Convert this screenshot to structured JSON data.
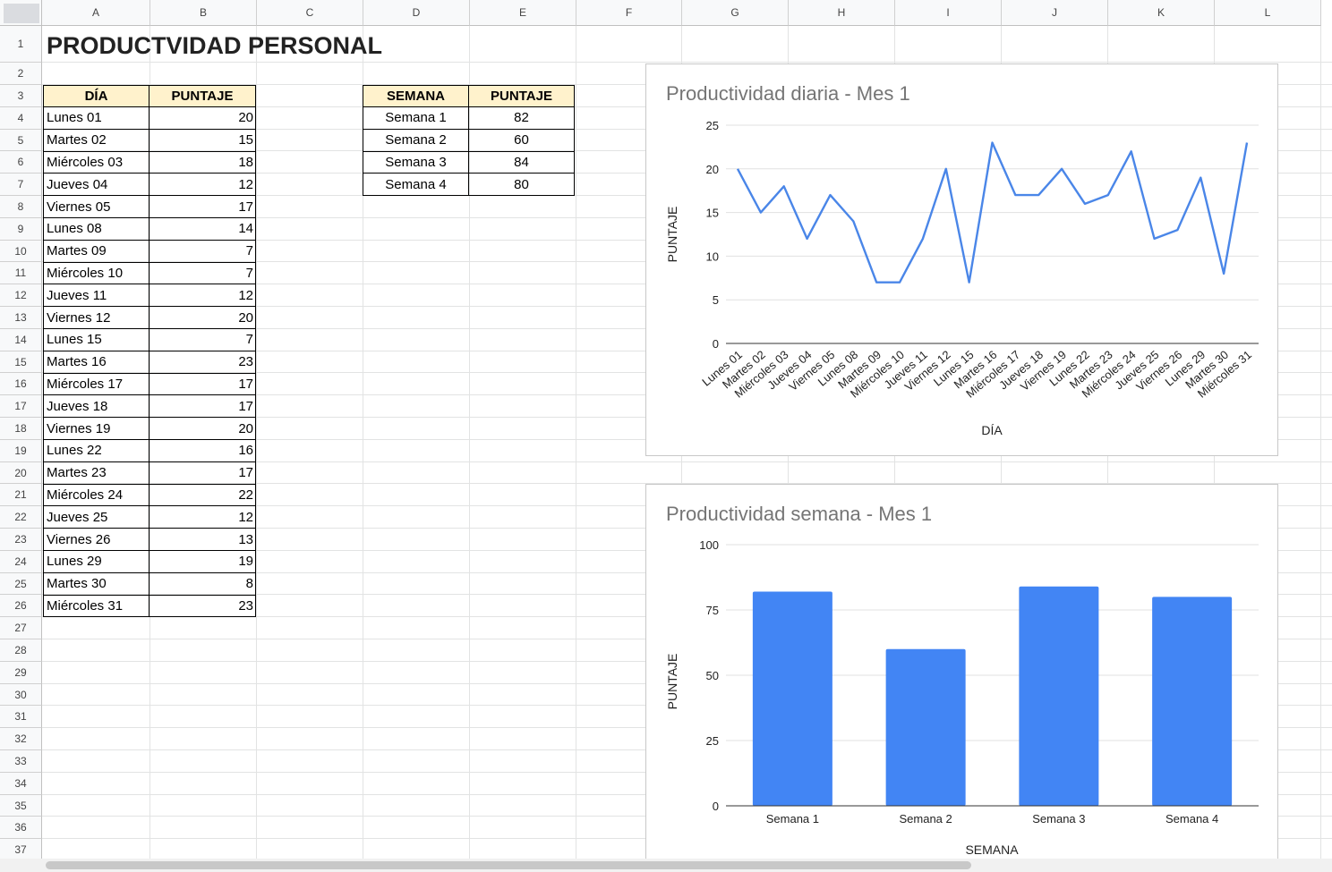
{
  "spreadsheet": {
    "columns": [
      "A",
      "B",
      "C",
      "D",
      "E",
      "F",
      "G",
      "H",
      "I",
      "J",
      "K",
      "L"
    ],
    "rows": [
      "1",
      "2",
      "3",
      "4",
      "5",
      "6",
      "7",
      "8",
      "9",
      "10",
      "11",
      "12",
      "13",
      "14",
      "15",
      "16",
      "17",
      "18",
      "19",
      "20",
      "21",
      "22",
      "23",
      "24",
      "25",
      "26",
      "27",
      "28",
      "29",
      "30",
      "31",
      "32",
      "33",
      "34",
      "35",
      "36",
      "37"
    ],
    "title": "PRODUCTVIDAD PERSONAL",
    "daily_table": {
      "headers": [
        "DÍA",
        "PUNTAJE"
      ],
      "rows": [
        [
          "Lunes 01",
          "20"
        ],
        [
          "Martes 02",
          "15"
        ],
        [
          "Miércoles 03",
          "18"
        ],
        [
          "Jueves 04",
          "12"
        ],
        [
          "Viernes 05",
          "17"
        ],
        [
          "Lunes 08",
          "14"
        ],
        [
          "Martes 09",
          "7"
        ],
        [
          "Miércoles 10",
          "7"
        ],
        [
          "Jueves 11",
          "12"
        ],
        [
          "Viernes 12",
          "20"
        ],
        [
          "Lunes 15",
          "7"
        ],
        [
          "Martes 16",
          "23"
        ],
        [
          "Miércoles 17",
          "17"
        ],
        [
          "Jueves 18",
          "17"
        ],
        [
          "Viernes 19",
          "20"
        ],
        [
          "Lunes 22",
          "16"
        ],
        [
          "Martes 23",
          "17"
        ],
        [
          "Miércoles 24",
          "22"
        ],
        [
          "Jueves 25",
          "12"
        ],
        [
          "Viernes 26",
          "13"
        ],
        [
          "Lunes 29",
          "19"
        ],
        [
          "Martes 30",
          "8"
        ],
        [
          "Miércoles 31",
          "23"
        ]
      ]
    },
    "weekly_table": {
      "headers": [
        "SEMANA",
        "PUNTAJE"
      ],
      "rows": [
        [
          "Semana 1",
          "82"
        ],
        [
          "Semana 2",
          "60"
        ],
        [
          "Semana 3",
          "84"
        ],
        [
          "Semana 4",
          "80"
        ]
      ]
    }
  },
  "chart_data": [
    {
      "type": "line",
      "title": "Productividad diaria - Mes 1",
      "xlabel": "DÍA",
      "ylabel": "PUNTAJE",
      "ylim": [
        0,
        25
      ],
      "yticks": [
        "0",
        "5",
        "10",
        "15",
        "20",
        "25"
      ],
      "grid": true,
      "color": "#4a86e8",
      "categories": [
        "Lunes 01",
        "Martes 02",
        "Miércoles 03",
        "Jueves 04",
        "Viernes 05",
        "Lunes 08",
        "Martes 09",
        "Miércoles 10",
        "Jueves 11",
        "Viernes 12",
        "Lunes 15",
        "Martes 16",
        "Miércoles 17",
        "Jueves 18",
        "Viernes 19",
        "Lunes 22",
        "Martes 23",
        "Miércoles 24",
        "Jueves 25",
        "Viernes 26",
        "Lunes 29",
        "Martes 30",
        "Miércoles 31"
      ],
      "values": [
        20,
        15,
        18,
        12,
        17,
        14,
        7,
        7,
        12,
        20,
        7,
        23,
        17,
        17,
        20,
        16,
        17,
        22,
        12,
        13,
        19,
        8,
        23
      ]
    },
    {
      "type": "bar",
      "title": "Productividad semana - Mes 1",
      "xlabel": "SEMANA",
      "ylabel": "PUNTAJE",
      "ylim": [
        0,
        100
      ],
      "yticks": [
        "0",
        "25",
        "50",
        "75",
        "100"
      ],
      "grid": true,
      "color": "#4285f4",
      "categories": [
        "Semana 1",
        "Semana 2",
        "Semana 3",
        "Semana 4"
      ],
      "values": [
        82,
        60,
        84,
        80
      ]
    }
  ]
}
